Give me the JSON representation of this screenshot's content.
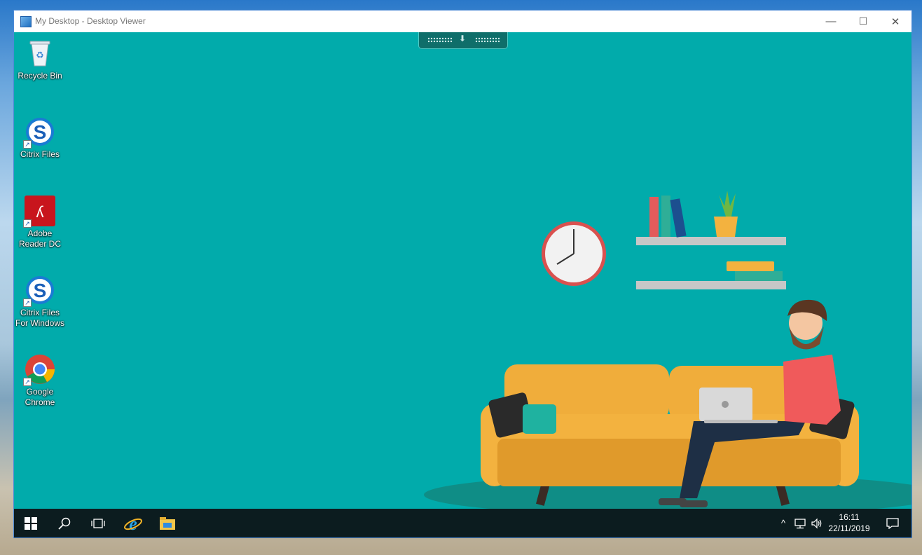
{
  "window": {
    "title": "My Desktop - Desktop Viewer",
    "controls": {
      "minimize": "—",
      "maximize": "☐",
      "close": "✕"
    }
  },
  "desktop": {
    "background_color": "#01abab",
    "icons": [
      {
        "name": "recycle-bin",
        "label": "Recycle Bin",
        "icon": "recycle-bin-icon",
        "shortcut": false
      },
      {
        "name": "citrix-files",
        "label": "Citrix Files",
        "icon": "citrix-files-icon",
        "shortcut": true
      },
      {
        "name": "adobe-reader",
        "label": "Adobe\nReader DC",
        "icon": "adobe-reader-icon",
        "shortcut": true
      },
      {
        "name": "citrix-files-windows",
        "label": "Citrix Files\nFor Windows",
        "icon": "citrix-files-icon",
        "shortcut": true
      },
      {
        "name": "google-chrome",
        "label": "Google\nChrome",
        "icon": "chrome-icon",
        "shortcut": true
      }
    ]
  },
  "taskbar": {
    "apps": [
      "start-icon",
      "search-icon",
      "task-view-icon",
      "internet-explorer-icon",
      "file-explorer-icon"
    ],
    "tray": {
      "chevron": "^",
      "network": "network-icon",
      "volume": "volume-icon"
    },
    "time": "16:11",
    "date": "22/11/2019"
  },
  "colors": {
    "accent_teal": "#01abab",
    "taskbar": "#0c1c1f",
    "sofa": "#f3b23f",
    "shirt": "#f05a5b"
  }
}
